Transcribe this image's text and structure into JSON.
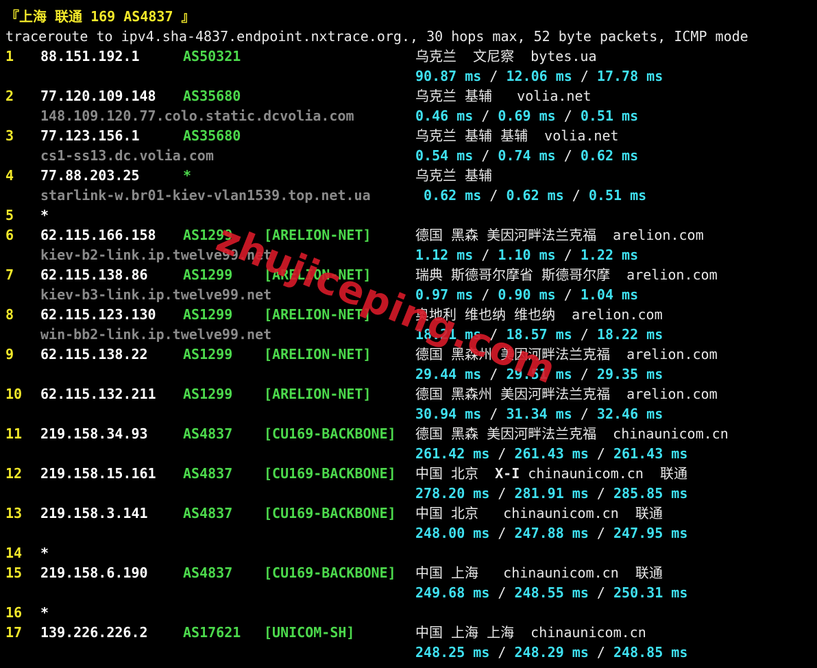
{
  "title": "『上海 联通 169 AS4837 』",
  "command": "traceroute to ipv4.sha-4837.endpoint.nxtrace.org., 30 hops max, 52 byte packets, ICMP mode",
  "watermark": "zhujiceping.com",
  "hops": [
    {
      "num": "1",
      "ip": "88.151.192.1",
      "asn": "AS50321",
      "tag": "",
      "geo": "乌克兰  文尼察  bytes.ua",
      "host": "",
      "rtt": [
        "90.87 ms",
        "12.06 ms",
        "17.78 ms"
      ]
    },
    {
      "num": "2",
      "ip": "77.120.109.148",
      "asn": "AS35680",
      "tag": "",
      "geo": "乌克兰 基辅   volia.net",
      "host": "148.109.120.77.colo.static.dcvolia.com",
      "rtt": [
        "0.46 ms",
        "0.69 ms",
        "0.51 ms"
      ]
    },
    {
      "num": "3",
      "ip": "77.123.156.1",
      "asn": "AS35680",
      "tag": "",
      "geo": "乌克兰 基辅 基辅  volia.net",
      "host": "cs1-ss13.dc.volia.com",
      "rtt": [
        "0.54 ms",
        "0.74 ms",
        "0.62 ms"
      ]
    },
    {
      "num": "4",
      "ip": "77.88.203.25",
      "asn": "*",
      "tag": "",
      "geo": "乌克兰 基辅",
      "host": "starlink-w.br01-kiev-vlan1539.top.net.ua",
      "rtt": [
        "0.62 ms",
        "0.62 ms",
        "0.51 ms"
      ]
    },
    {
      "num": "5",
      "star": true
    },
    {
      "num": "6",
      "ip": "62.115.166.158",
      "asn": "AS1299",
      "tag": "[ARELION-NET]",
      "geo": "德国 黑森 美因河畔法兰克福  arelion.com",
      "host": "kiev-b2-link.ip.twelve99.net",
      "rtt": [
        "1.12 ms",
        "1.10 ms",
        "1.22 ms"
      ]
    },
    {
      "num": "7",
      "ip": "62.115.138.86",
      "asn": "AS1299",
      "tag": "[ARELION-NET]",
      "geo": "瑞典 斯德哥尔摩省 斯德哥尔摩  arelion.com",
      "host": "kiev-b3-link.ip.twelve99.net",
      "rtt": [
        "0.97 ms",
        "0.90 ms",
        "1.04 ms"
      ]
    },
    {
      "num": "8",
      "ip": "62.115.123.130",
      "asn": "AS1299",
      "tag": "[ARELION-NET]",
      "geo": "奥地利 维也纳 维也纳  arelion.com",
      "host": "win-bb2-link.ip.twelve99.net",
      "rtt": [
        "18.21 ms",
        "18.57 ms",
        "18.22 ms"
      ]
    },
    {
      "num": "9",
      "ip": "62.115.138.22",
      "asn": "AS1299",
      "tag": "[ARELION-NET]",
      "geo": "德国 黑森州 美因河畔法兰克福  arelion.com",
      "host": "",
      "rtt": [
        "29.44 ms",
        "29.51 ms",
        "29.35 ms"
      ]
    },
    {
      "num": "10",
      "ip": "62.115.132.211",
      "asn": "AS1299",
      "tag": "[ARELION-NET]",
      "geo": "德国 黑森州 美因河畔法兰克福  arelion.com",
      "host": "",
      "rtt": [
        "30.94 ms",
        "31.34 ms",
        "32.46 ms"
      ]
    },
    {
      "num": "11",
      "ip": "219.158.34.93",
      "asn": "AS4837",
      "tag": "[CU169-BACKBONE]",
      "geo": "德国 黑森 美因河畔法兰克福  chinaunicom.cn",
      "host": "",
      "rtt": [
        "261.42 ms",
        "261.43 ms",
        "261.43 ms"
      ]
    },
    {
      "num": "12",
      "ip": "219.158.15.161",
      "asn": "AS4837",
      "tag": "[CU169-BACKBONE]",
      "geo": "中国 北京  ",
      "geo_strong": "X-I",
      "geo_tail": " chinaunicom.cn  联通",
      "host": "",
      "rtt": [
        "278.20 ms",
        "281.91 ms",
        "285.85 ms"
      ]
    },
    {
      "num": "13",
      "ip": "219.158.3.141",
      "asn": "AS4837",
      "tag": "[CU169-BACKBONE]",
      "geo": "中国 北京   chinaunicom.cn  联通",
      "host": "",
      "rtt": [
        "248.00 ms",
        "247.88 ms",
        "247.95 ms"
      ]
    },
    {
      "num": "14",
      "star": true
    },
    {
      "num": "15",
      "ip": "219.158.6.190",
      "asn": "AS4837",
      "tag": "[CU169-BACKBONE]",
      "geo": "中国 上海   chinaunicom.cn  联通",
      "host": "",
      "rtt": [
        "249.68 ms",
        "248.55 ms",
        "250.31 ms"
      ]
    },
    {
      "num": "16",
      "star": true
    },
    {
      "num": "17",
      "ip": "139.226.226.2",
      "asn": "AS17621",
      "tag": "[UNICOM-SH]",
      "geo": "中国 上海 上海  chinaunicom.cn",
      "host": "",
      "rtt": [
        "248.25 ms",
        "248.29 ms",
        "248.85 ms"
      ]
    }
  ]
}
